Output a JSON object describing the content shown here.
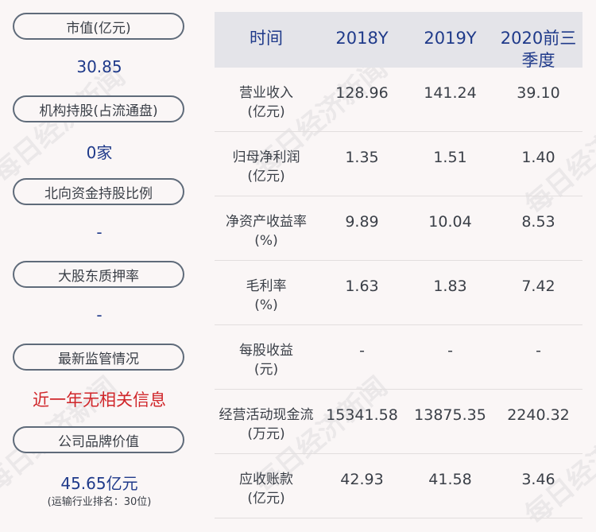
{
  "left_panel": {
    "items": [
      {
        "label": "市值(亿元)",
        "value": "30.85"
      },
      {
        "label": "机构持股(占流通盘)",
        "value": "0家"
      },
      {
        "label": "北向资金持股比例",
        "value": "-"
      },
      {
        "label": "大股东质押率",
        "value": "-"
      },
      {
        "label": "最新监管情况",
        "value": "近一年无相关信息"
      },
      {
        "label": "公司品牌价值",
        "value": "45.65亿元",
        "note": "(运输行业排名：30位)"
      }
    ]
  },
  "table": {
    "headers": [
      "时间",
      "2018Y",
      "2019Y",
      "2020前三季度"
    ],
    "rows": [
      {
        "label1": "营业收入",
        "label2": "(亿元)",
        "values": [
          "128.96",
          "141.24",
          "39.10"
        ]
      },
      {
        "label1": "归母净利润",
        "label2": "(亿元)",
        "values": [
          "1.35",
          "1.51",
          "1.40"
        ]
      },
      {
        "label1": "净资产收益率",
        "label2": "(%)",
        "values": [
          "9.89",
          "10.04",
          "8.53"
        ]
      },
      {
        "label1": "毛利率",
        "label2": "(%)",
        "values": [
          "1.63",
          "1.83",
          "7.42"
        ]
      },
      {
        "label1": "每股收益",
        "label2": "(元)",
        "values": [
          "-",
          "-",
          "-"
        ]
      },
      {
        "label1": "经营活动现金流",
        "label2": "(万元)",
        "values": [
          "15341.58",
          "13875.35",
          "2240.32"
        ]
      },
      {
        "label1": "应收账款",
        "label2": "(亿元)",
        "values": [
          "42.93",
          "41.58",
          "3.46"
        ]
      }
    ]
  },
  "watermark": "每日经济新闻",
  "colors": {
    "value_blue": "#1f3a8a",
    "alert_red": "#d0262a",
    "header_bg": "#e4e4e9"
  }
}
